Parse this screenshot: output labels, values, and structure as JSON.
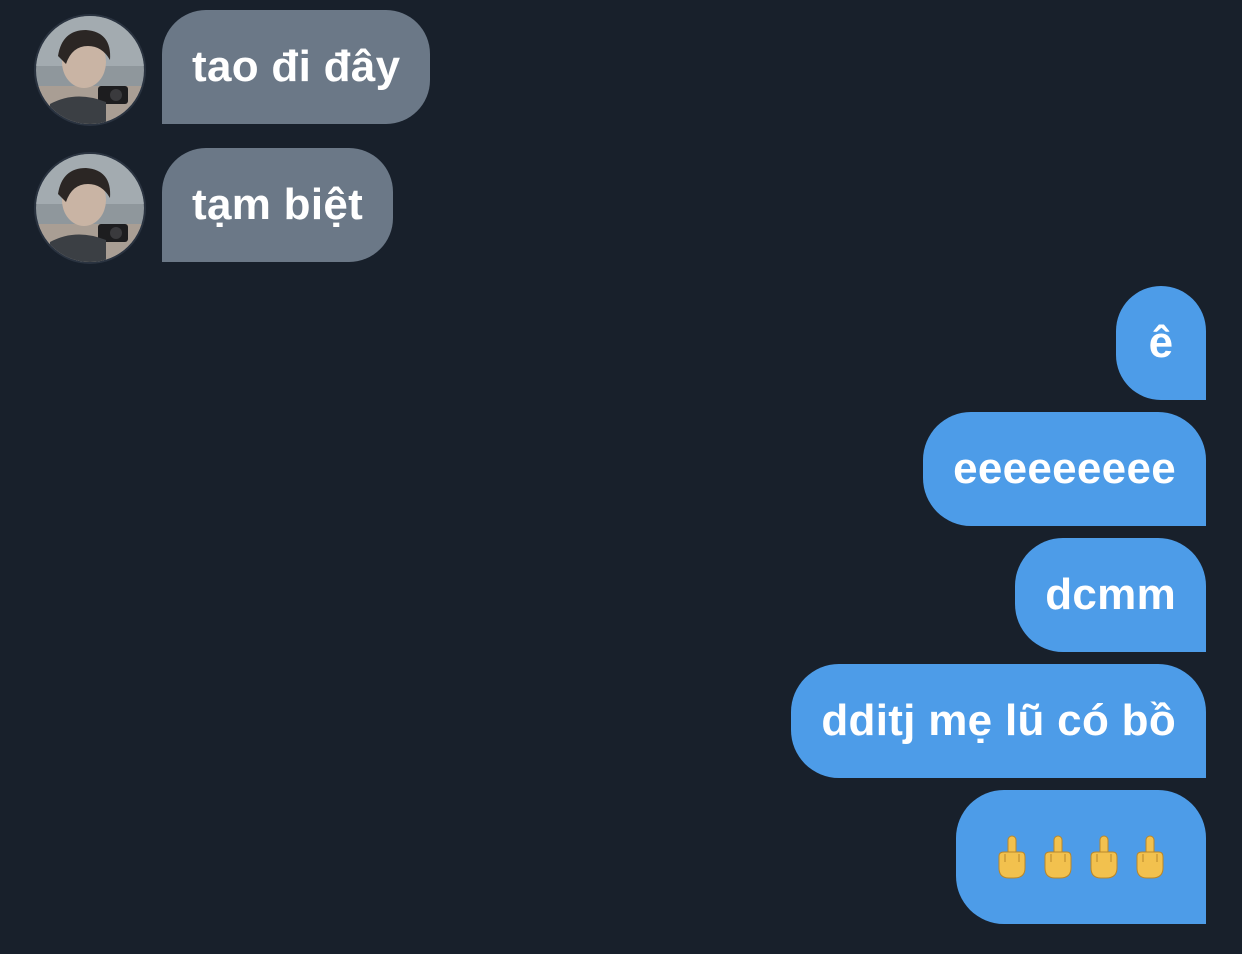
{
  "conversation": {
    "incoming": [
      {
        "text": "tao đi đây"
      },
      {
        "text": "tạm biệt"
      }
    ],
    "outgoing": [
      {
        "text": "ê"
      },
      {
        "text": "eeeeeeeee"
      },
      {
        "text": "dcmm"
      },
      {
        "text": "dditj mẹ lũ có bồ"
      },
      {
        "text": "🖕🖕🖕🖕",
        "emoji_count": 4,
        "emoji_icon": "middle-finger-icon"
      }
    ]
  },
  "colors": {
    "background": "#18202b",
    "incoming_bubble": "#6b7887",
    "outgoing_bubble": "#4d9ce8",
    "text": "#ffffff",
    "emoji": "#f2c14e"
  }
}
